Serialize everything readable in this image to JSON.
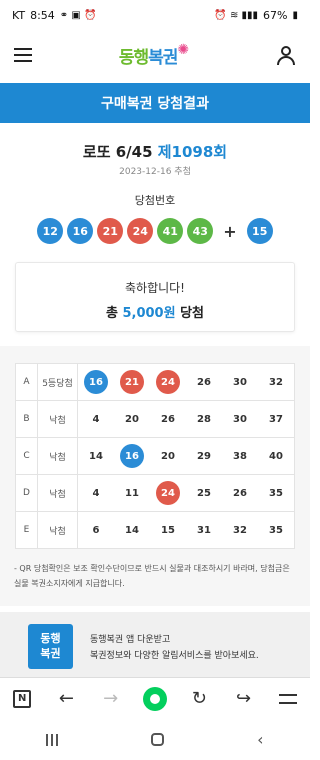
{
  "status_bar": {
    "carrier": "KT",
    "time": "8:54",
    "battery": "67%"
  },
  "header": {
    "logo_text_main": "동행",
    "logo_text_sub": "복권"
  },
  "page_title": "구매복권 당첨결과",
  "draw": {
    "game": "로또 6/45",
    "round": "제1098회",
    "date": "2023-12-16 추첨",
    "winning_label": "당첨번호",
    "numbers": [
      {
        "n": "12",
        "color": "#2b8cd6"
      },
      {
        "n": "16",
        "color": "#2b8cd6"
      },
      {
        "n": "21",
        "color": "#e05a4b"
      },
      {
        "n": "24",
        "color": "#e05a4b"
      },
      {
        "n": "41",
        "color": "#5db847"
      },
      {
        "n": "43",
        "color": "#5db847"
      }
    ],
    "plus": "+",
    "bonus": {
      "n": "15",
      "color": "#2b8cd6"
    }
  },
  "result": {
    "message": "축하합니다!",
    "prize_prefix": "총",
    "prize_amount": "5,000원",
    "prize_suffix": "당첨"
  },
  "games": [
    {
      "id": "A",
      "rank": "5등당첨",
      "nums": [
        {
          "n": "16",
          "hit": "#2b8cd6"
        },
        {
          "n": "21",
          "hit": "#e05a4b"
        },
        {
          "n": "24",
          "hit": "#e05a4b"
        },
        {
          "n": "26"
        },
        {
          "n": "30"
        },
        {
          "n": "32"
        }
      ]
    },
    {
      "id": "B",
      "rank": "낙첨",
      "nums": [
        {
          "n": "4"
        },
        {
          "n": "20"
        },
        {
          "n": "26"
        },
        {
          "n": "28"
        },
        {
          "n": "30"
        },
        {
          "n": "37"
        }
      ]
    },
    {
      "id": "C",
      "rank": "낙첨",
      "nums": [
        {
          "n": "14"
        },
        {
          "n": "16",
          "hit": "#2b8cd6"
        },
        {
          "n": "20"
        },
        {
          "n": "29"
        },
        {
          "n": "38"
        },
        {
          "n": "40"
        }
      ]
    },
    {
      "id": "D",
      "rank": "낙첨",
      "nums": [
        {
          "n": "4"
        },
        {
          "n": "11"
        },
        {
          "n": "24",
          "hit": "#e05a4b"
        },
        {
          "n": "25"
        },
        {
          "n": "26"
        },
        {
          "n": "35"
        }
      ]
    },
    {
      "id": "E",
      "rank": "낙첨",
      "nums": [
        {
          "n": "6"
        },
        {
          "n": "14"
        },
        {
          "n": "15"
        },
        {
          "n": "31"
        },
        {
          "n": "32"
        },
        {
          "n": "35"
        }
      ]
    }
  ],
  "notice": "- QR 당첨확인은 보조 확인수단이므로 반드시 실물과 대조하시기 바라며, 당첨금은 실물 복권소지자에게 지급합니다.",
  "promo": {
    "logo_line1": "동행",
    "logo_line2": "복권",
    "line1": "동행복권 앱 다운받고",
    "line2": "복권정보와 다양한 알림서비스를 받아보세요."
  },
  "toolbar": {
    "n_label": "N"
  }
}
